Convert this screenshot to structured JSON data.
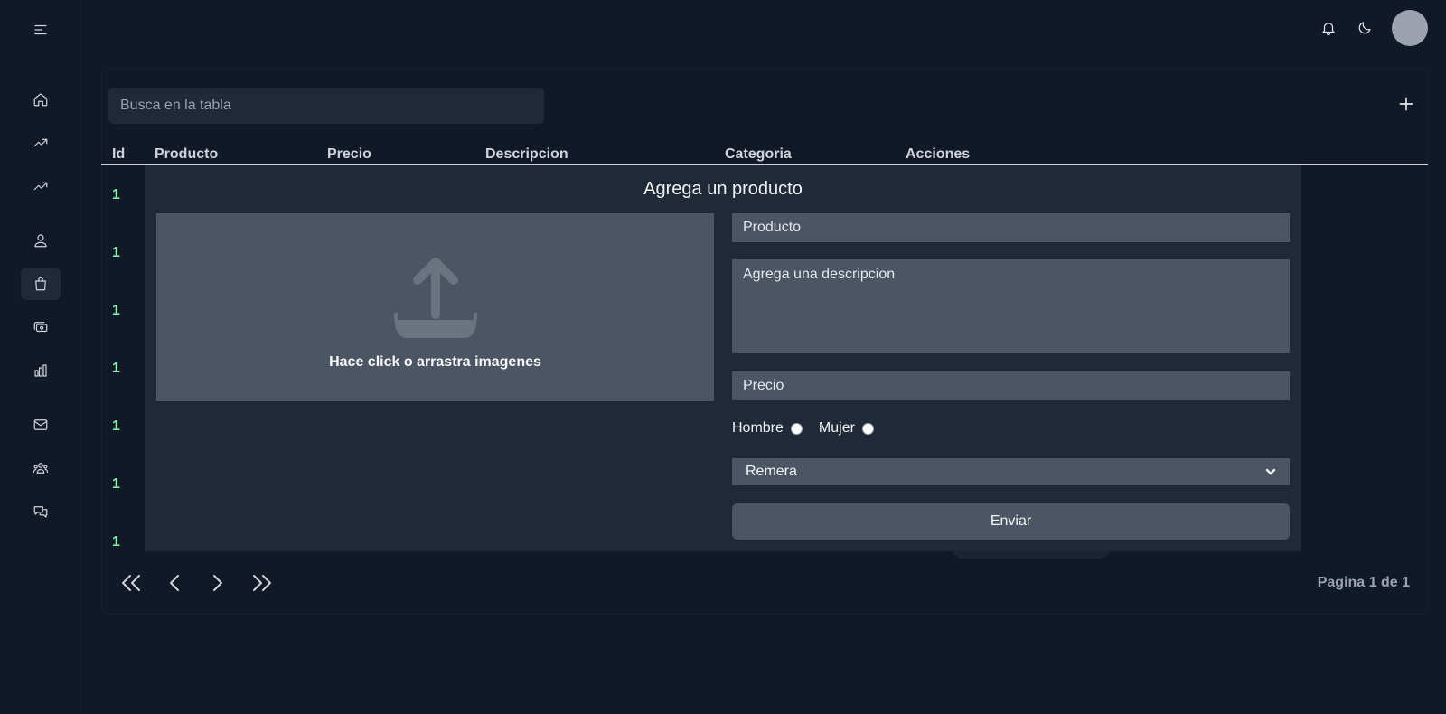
{
  "search": {
    "placeholder": "Busca en la tabla"
  },
  "table": {
    "headers": [
      "Id",
      "Producto",
      "Precio",
      "Descripcion",
      "Categoria",
      "Acciones"
    ],
    "rows": [
      {
        "id": "1"
      },
      {
        "id": "1"
      },
      {
        "id": "1"
      },
      {
        "id": "1"
      },
      {
        "id": "1"
      },
      {
        "id": "1"
      },
      {
        "id": "1"
      }
    ]
  },
  "pagination": {
    "info": "Pagina 1 de 1"
  },
  "modal": {
    "title": "Agrega un producto",
    "dropzone_label": "Hace click o arrastra imagenes",
    "product_placeholder": "Producto",
    "description_placeholder": "Agrega una descripcion",
    "price_placeholder": "Precio",
    "gender_options": [
      "Hombre",
      "Mujer"
    ],
    "category_selected": "Remera",
    "submit_label": "Enviar"
  },
  "icons": {
    "sidebar": [
      "menu-icon",
      "home-icon",
      "trending-up-icon",
      "trending-up-icon",
      "user-icon",
      "shopping-bag-icon",
      "cash-icon",
      "bar-chart-icon",
      "mail-icon",
      "users-icon",
      "chat-icon"
    ],
    "top": [
      "bell-icon",
      "moon-icon"
    ]
  },
  "colors": {
    "background": "#111827",
    "panel": "#1f2937",
    "field": "#4b5563",
    "id_text": "#86efac"
  }
}
